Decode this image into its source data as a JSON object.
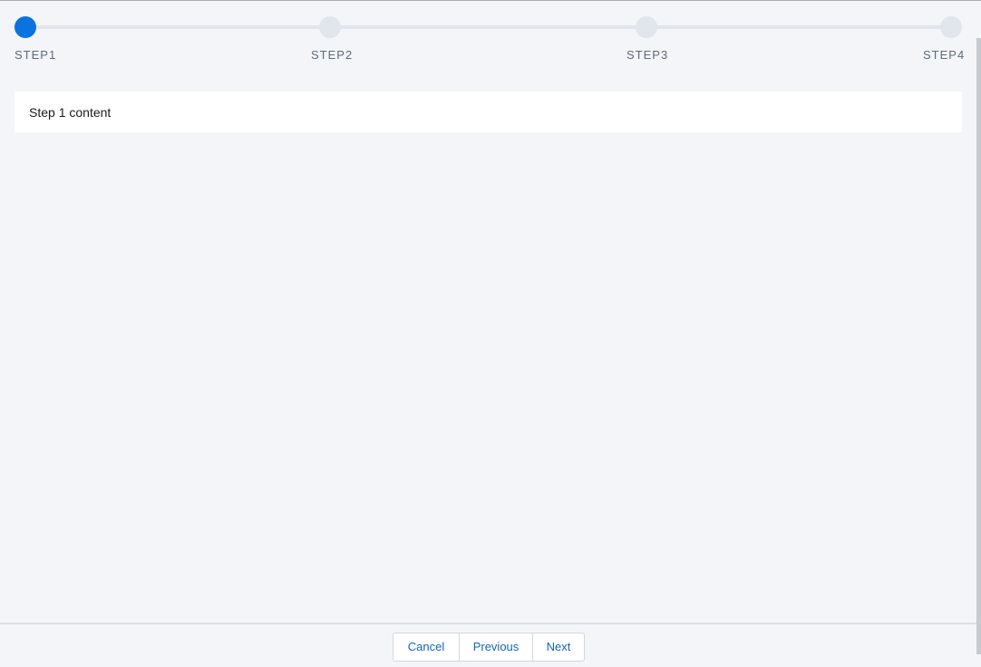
{
  "stepper": {
    "steps": [
      {
        "label": "STEP1",
        "state": "active"
      },
      {
        "label": "STEP2",
        "state": "inactive"
      },
      {
        "label": "STEP3",
        "state": "inactive"
      },
      {
        "label": "STEP4",
        "state": "inactive"
      }
    ],
    "colors": {
      "active": "#0b72df",
      "inactive": "#e1e5ec",
      "label": "#5f6a7a"
    }
  },
  "content": {
    "text": "Step 1 content"
  },
  "footer": {
    "cancel_label": "Cancel",
    "previous_label": "Previous",
    "next_label": "Next",
    "button_color": "#1463b8"
  }
}
